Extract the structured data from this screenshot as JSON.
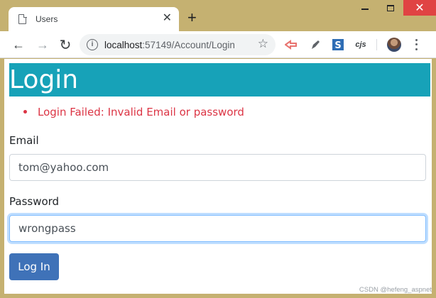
{
  "browser": {
    "tab_title": "Users",
    "tab_close": "✕",
    "new_tab": "+",
    "window_controls": {
      "close": "✕"
    },
    "url_host": "localhost",
    "url_path": ":57149/Account/Login",
    "nav": {
      "back": "←",
      "forward": "→",
      "reload": "↻"
    },
    "star": "☆",
    "extensions": [
      "cjs"
    ]
  },
  "page": {
    "heading": "Login",
    "errors": [
      "Login Failed: Invalid Email or password"
    ],
    "email_label": "Email",
    "email_value": "tom@yahoo.com",
    "password_label": "Password",
    "password_value": "wrongpass",
    "login_button": "Log In"
  },
  "watermark": "CSDN @hefeng_aspnet",
  "colors": {
    "heading_bg": "#17a2b8",
    "error": "#dc3545",
    "button_bg": "#3f72b8",
    "frame": "#c5b171",
    "close_btn": "#e04343"
  }
}
